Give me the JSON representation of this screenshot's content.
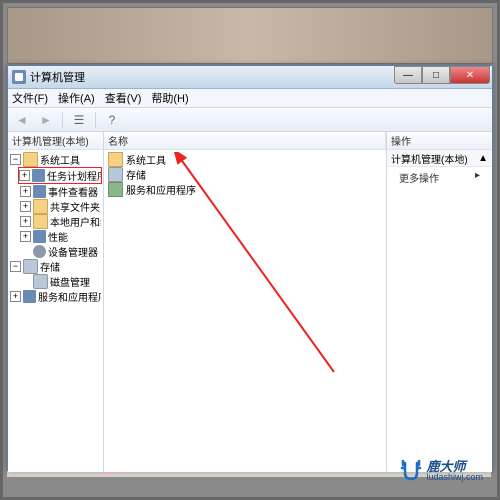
{
  "window": {
    "title": "计算机管理",
    "buttons": {
      "min": "—",
      "max": "□",
      "close": "✕"
    }
  },
  "menu": {
    "file": "文件(F)",
    "action": "操作(A)",
    "view": "查看(V)",
    "help": "帮助(H)"
  },
  "toolbar": {
    "back": "◄",
    "fwd": "►",
    "props": "☰",
    "help": "?"
  },
  "tree": {
    "header": "计算机管理(本地)",
    "root": {
      "label": "系统工具",
      "expanded": true
    },
    "nodes": [
      {
        "label": "任务计划程序",
        "icon": "clock",
        "highlight": true,
        "indent": 1,
        "twist": "+"
      },
      {
        "label": "事件查看器",
        "icon": "app",
        "indent": 1,
        "twist": "+"
      },
      {
        "label": "共享文件夹",
        "icon": "folder",
        "indent": 1,
        "twist": "+"
      },
      {
        "label": "本地用户和组",
        "icon": "folder",
        "indent": 1,
        "twist": "+"
      },
      {
        "label": "性能",
        "icon": "app",
        "indent": 1,
        "twist": "+"
      },
      {
        "label": "设备管理器",
        "icon": "cog",
        "indent": 1,
        "twist": ""
      }
    ],
    "storage": {
      "label": "存储",
      "expanded": true
    },
    "storage_nodes": [
      {
        "label": "磁盘管理",
        "icon": "disk",
        "indent": 1,
        "twist": ""
      }
    ],
    "services": {
      "label": "服务和应用程序",
      "icon": "app",
      "twist": "+"
    }
  },
  "list": {
    "columns": [
      "名称"
    ],
    "items": [
      {
        "label": "系统工具",
        "icon": "fold"
      },
      {
        "label": "存储",
        "icon": "stor"
      },
      {
        "label": "服务和应用程序",
        "icon": "svc"
      }
    ]
  },
  "actions": {
    "header": "操作",
    "group": "计算机管理(本地)",
    "more": "更多操作",
    "arrow": "▲",
    "menu_arrow": "▸"
  },
  "watermark": {
    "cn": "鹿大师",
    "url": "ludashiwj.com"
  }
}
